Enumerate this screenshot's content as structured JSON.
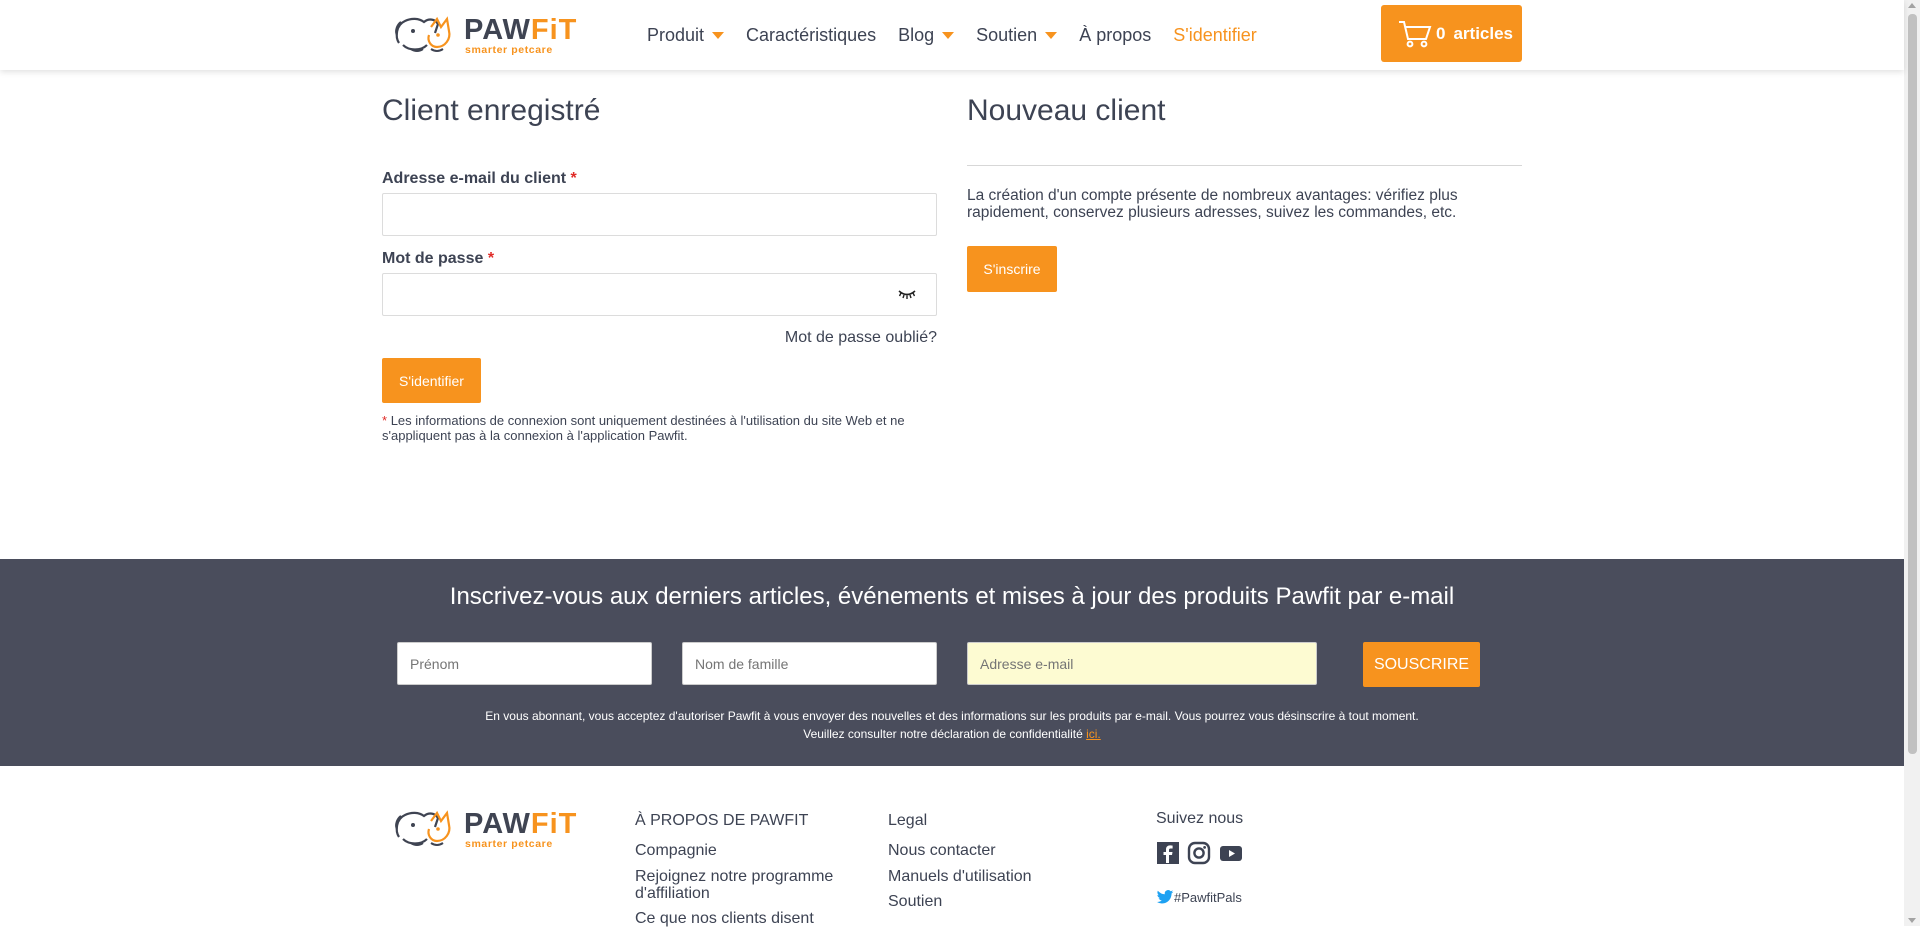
{
  "header": {
    "logo_word_paw": "PAW",
    "logo_word_fit": "FiT",
    "logo_tagline": "smarter petcare",
    "nav": [
      {
        "label": "Produit",
        "dropdown": true
      },
      {
        "label": "Caractéristiques",
        "dropdown": false
      },
      {
        "label": "Blog",
        "dropdown": true
      },
      {
        "label": "Soutien",
        "dropdown": true
      },
      {
        "label": "À propos",
        "dropdown": false
      },
      {
        "label": "S'identifier",
        "dropdown": false,
        "active": true
      }
    ],
    "cart": {
      "count": "0",
      "label": "articles"
    }
  },
  "login": {
    "title": "Client enregistré",
    "email_label": "Adresse e-mail du client",
    "password_label": "Mot de passe",
    "required_mark": "*",
    "email_value": "",
    "password_value": "",
    "forgot_label": "Mot de passe oublié?",
    "submit_label": "S'identifier",
    "note_mark": "*",
    "note": "Les informations de connexion sont uniquement destinées à l'utilisation du site Web et ne s'appliquent pas à la connexion à l'application Pawfit."
  },
  "register": {
    "title": "Nouveau client",
    "text": "La création d'un compte présente de nombreux avantages: vérifiez plus rapidement, conservez plusieurs adresses, suivez les commandes, etc.",
    "button_label": "S'inscrire"
  },
  "newsletter": {
    "title": "Inscrivez-vous aux derniers articles, événements et mises à jour des produits Pawfit par e-mail",
    "first_name_placeholder": "Prénom",
    "last_name_placeholder": "Nom de famille",
    "email_placeholder": "Adresse e-mail",
    "subscribe_label": "SOUSCRIRE",
    "note_line1": "En vous abonnant, vous acceptez d'autoriser Pawfit à vous envoyer des nouvelles et des informations sur les produits par e-mail. Vous pourrez vous désinscrire à tout moment.",
    "note_line2": "Veuillez consulter notre déclaration de confidentialité",
    "note_link": "ici."
  },
  "footer": {
    "about_heading": "À PROPOS DE PAWFIT",
    "about_links": [
      "Compagnie",
      "Rejoignez notre programme d'affiliation",
      "Ce que nos clients disent"
    ],
    "legal_heading": "Legal",
    "legal_links": [
      "Nous contacter",
      "Manuels d'utilisation",
      "Soutien"
    ],
    "follow_heading": "Suivez nous",
    "social_icons": [
      "facebook-icon",
      "instagram-icon",
      "youtube-icon"
    ],
    "twitter_tag": "#PawfitPals"
  },
  "colors": {
    "accent": "#f7931e",
    "text": "#3d4353",
    "band": "#4a4d5c",
    "required": "#e02b27"
  }
}
